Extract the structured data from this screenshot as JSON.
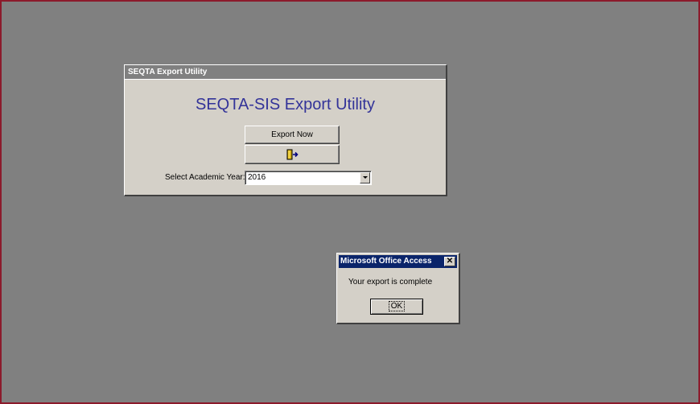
{
  "form": {
    "title": "SEQTA Export Utility",
    "heading": "SEQTA-SIS Export Utility",
    "export_button_label": "Export Now",
    "exit_icon": "exit-door-icon",
    "year_label": "Select Academic Year:",
    "year_value": "2016"
  },
  "message_box": {
    "title": "Microsoft Office Access",
    "close_glyph": "✕",
    "message": "Your export is complete",
    "ok_label": "OK"
  },
  "colors": {
    "heading": "#333399",
    "msg_titlebar": "#0a246a",
    "desktop": "#808080",
    "frame_border": "#8b1a2b"
  }
}
